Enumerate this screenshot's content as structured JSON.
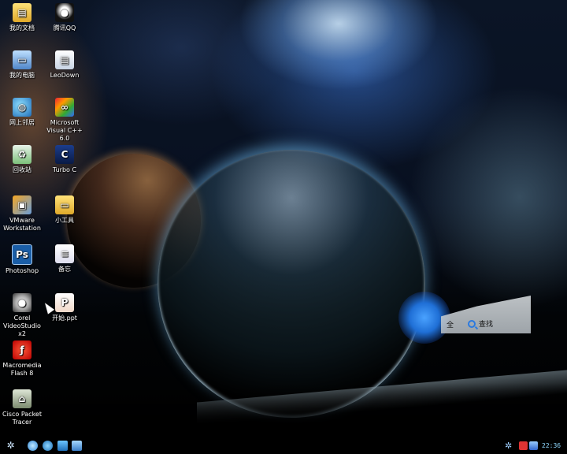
{
  "desktop": {
    "icons_left": [
      {
        "label": "我的文档",
        "icon": "folder-documents-icon"
      },
      {
        "label": "我的电脑",
        "icon": "computer-icon"
      },
      {
        "label": "网上邻居",
        "icon": "network-icon"
      },
      {
        "label": "回收站",
        "icon": "recycle-bin-icon"
      },
      {
        "label": "VMware Workstation",
        "icon": "vmware-icon"
      },
      {
        "label": "Photoshop",
        "icon": "photoshop-icon",
        "glyph": "Ps"
      },
      {
        "label": "Corel VideoStudio x2",
        "icon": "corel-icon"
      },
      {
        "label": "Macromedia Flash 8",
        "icon": "flash-icon"
      },
      {
        "label": "Cisco Packet Tracer",
        "icon": "cisco-icon"
      }
    ],
    "icons_right": [
      {
        "label": "腾讯QQ",
        "icon": "qq-icon"
      },
      {
        "label": "LeoDown",
        "icon": "document-icon"
      },
      {
        "label": "Microsoft Visual C++ 6.0",
        "icon": "msvc-icon"
      },
      {
        "label": "Turbo C",
        "icon": "turbo-c-icon"
      },
      {
        "label": "小工具",
        "icon": "folder-icon"
      },
      {
        "label": "备忘",
        "icon": "note-icon"
      },
      {
        "label": "开始.ppt",
        "icon": "ppt-icon"
      }
    ]
  },
  "panel": {
    "partial_label": "全",
    "search_label": "查找"
  },
  "taskbar": {
    "clock": "22:36"
  },
  "colors": {
    "clock": "#8fd8ff",
    "panel_bg": "#d4d9dd"
  }
}
